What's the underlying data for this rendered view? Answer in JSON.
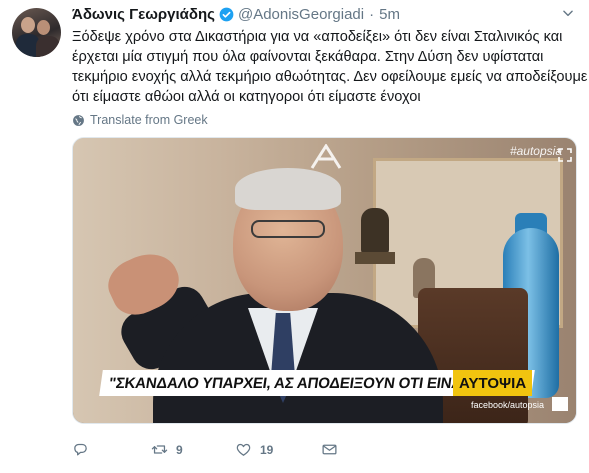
{
  "tweet": {
    "author_name": "Άδωνις Γεωργιάδης",
    "handle": "@AdonisGeorgiadi",
    "separator": "·",
    "time": "5m",
    "text_lines": [
      "Ξόδεψε χρόνο στα Δικαστήρια για να «αποδείξει» ότι δεν είναι Σταλινικός και",
      "έρχεται μία στιγμή που όλα φαίνονται ξεκάθαρα. Στην Δύση δεν υφίσταται",
      "τεκμήριο ενοχής αλλά τεκμήριο αθωότητας. Δεν οφείλουμε εμείς να αποδείξουμε",
      "ότι είμαστε αθώοι αλλά οι κατηγοροι ότι είμαστε ένοχοι"
    ],
    "translate_label": "Translate from Greek",
    "verified_color": "#1da1f2"
  },
  "media": {
    "banner_text": "\"ΣΚΑΝΔΑΛΟ ΥΠΑΡΧΕΙ, ΑΣ ΑΠΟΔΕΙΞΟΥΝ ΟΤΙ ΕΙΝΑΙ ΑΘΩΟΙ\"",
    "brand_label": "ΑΥΤΟΨΙΑ",
    "watermark": "#autopsia",
    "fb_tag": "facebook/autopsia"
  },
  "actions": {
    "reply_icon": "reply-icon",
    "retweet_count": "9",
    "like_count": "19",
    "dm_icon": "envelope-icon"
  }
}
